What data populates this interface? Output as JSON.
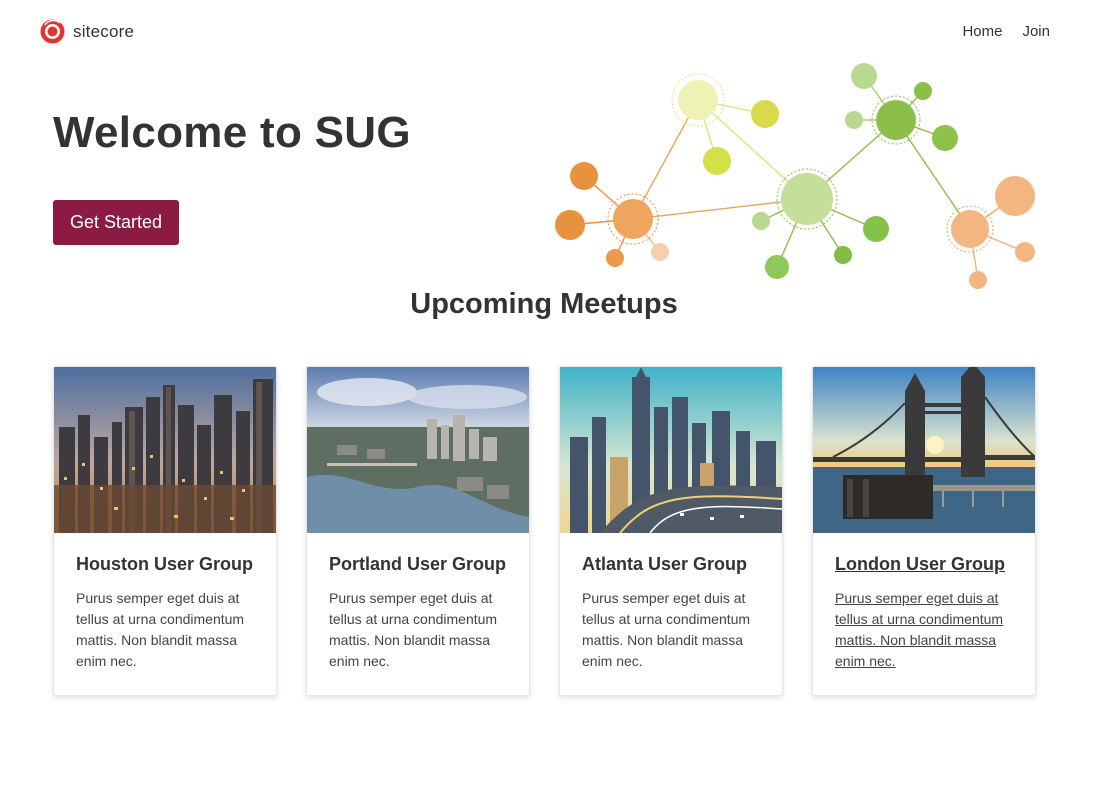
{
  "nav": {
    "logo_text": "sitecore",
    "links": [
      "Home",
      "Join"
    ]
  },
  "hero": {
    "title": "Welcome to SUG",
    "cta_label": "Get Started"
  },
  "meetups": {
    "heading": "Upcoming Meetups",
    "cards": [
      {
        "title": "Houston User Group",
        "description": "Purus semper eget duis at tellus at urna condimentum mattis. Non blandit massa enim nec.",
        "image": "houston-skyline-photo"
      },
      {
        "title": "Portland User Group",
        "description": "Purus semper eget duis at tellus at urna condimentum mattis. Non blandit massa enim nec.",
        "image": "portland-aerial-photo"
      },
      {
        "title": "Atlanta User Group",
        "description": "Purus semper eget duis at tellus at urna condimentum mattis. Non blandit massa enim nec.",
        "image": "atlanta-highway-photo"
      },
      {
        "title": "London User Group",
        "description": "Purus semper eget duis at tellus at urna condimentum mattis. Non blandit massa enim nec.",
        "image": "london-tower-bridge-photo",
        "hovered": true
      }
    ]
  },
  "colors": {
    "brand": "#8b1b42",
    "logo_red": "#e2352b",
    "text": "#333333",
    "network_orange": "#e8913f",
    "network_green": "#8cbf4a",
    "network_yellow": "#d9dc4a"
  }
}
